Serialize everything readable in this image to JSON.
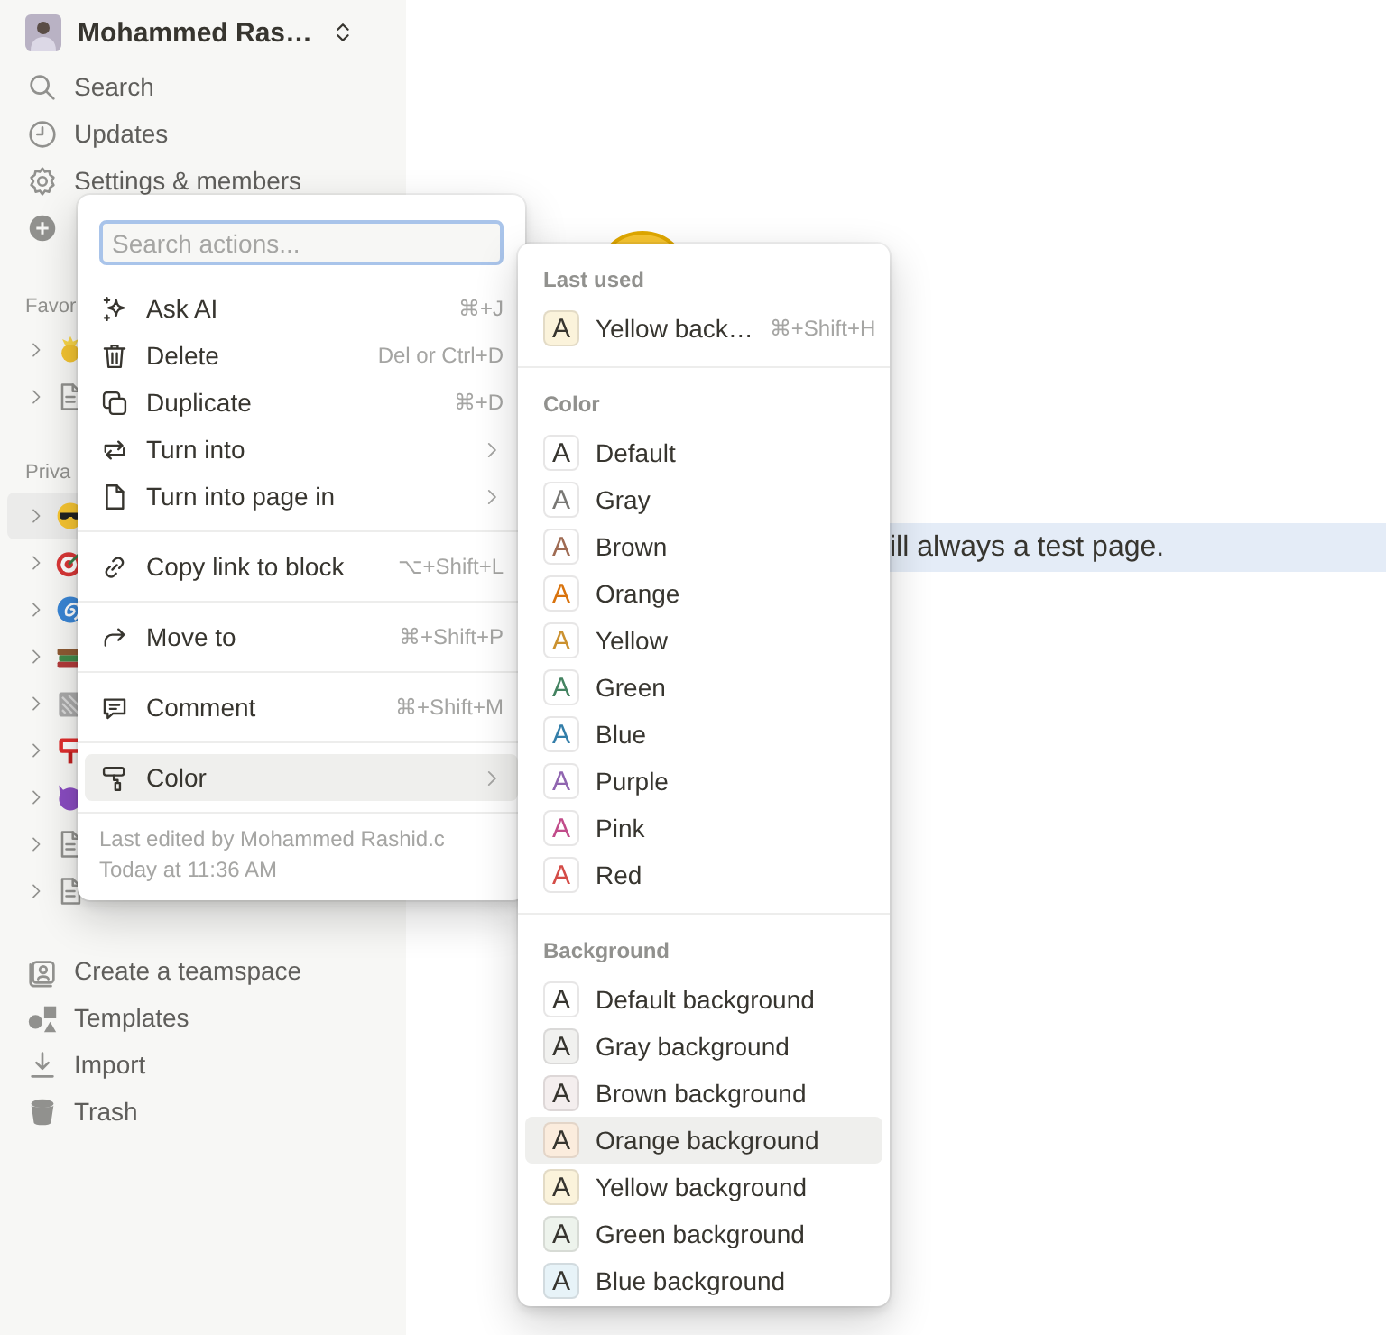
{
  "sidebar": {
    "workspace": {
      "name": "Mohammed Ras…"
    },
    "nav": [
      {
        "label": "Search"
      },
      {
        "label": "Updates"
      },
      {
        "label": "Settings & members"
      }
    ],
    "favorites": {
      "heading": "Favor",
      "pages": [
        {
          "selected": false
        },
        {
          "selected": false
        }
      ]
    },
    "private": {
      "heading": "Priva",
      "pages": [
        {
          "selected": true
        },
        {
          "selected": false
        },
        {
          "selected": false
        },
        {
          "selected": false
        },
        {
          "selected": false
        },
        {
          "selected": false
        },
        {
          "selected": false
        },
        {
          "selected": false
        },
        {
          "selected": false
        }
      ]
    },
    "footer": [
      {
        "label": "Create a teamspace"
      },
      {
        "label": "Templates"
      },
      {
        "label": "Import"
      },
      {
        "label": "Trash"
      }
    ]
  },
  "page": {
    "block": {
      "text": "ill always a test page.",
      "selected": true
    }
  },
  "action_menu": {
    "search": {
      "placeholder": "Search actions..."
    },
    "groups": [
      [
        {
          "label": "Ask AI",
          "shortcut": "⌘+J",
          "submenu": false,
          "selected": false
        },
        {
          "label": "Delete",
          "shortcut": "Del or Ctrl+D",
          "submenu": false,
          "selected": false
        },
        {
          "label": "Duplicate",
          "shortcut": "⌘+D",
          "submenu": false,
          "selected": false
        },
        {
          "label": "Turn into",
          "submenu": true,
          "selected": false
        },
        {
          "label": "Turn into page in",
          "submenu": true,
          "selected": false
        }
      ],
      [
        {
          "label": "Copy link to block",
          "shortcut": "⌥+Shift+L",
          "submenu": false,
          "selected": false
        }
      ],
      [
        {
          "label": "Move to",
          "shortcut": "⌘+Shift+P",
          "submenu": false,
          "selected": false
        }
      ],
      [
        {
          "label": "Comment",
          "shortcut": "⌘+Shift+M",
          "submenu": false,
          "selected": false
        }
      ],
      [
        {
          "label": "Color",
          "submenu": true,
          "selected": true
        }
      ]
    ],
    "footer": {
      "edited_by": "Last edited by Mohammed Rashid.c",
      "edited_at": "Today at 11:36 AM"
    }
  },
  "color_menu": {
    "sections": [
      {
        "heading": "Last used",
        "items": [
          {
            "kind": "background",
            "glyph": "A",
            "label": "Yellow back…",
            "shortcut": "⌘+Shift+H",
            "color": "#fbf3db",
            "selected": false
          }
        ]
      },
      {
        "heading": "Color",
        "items": [
          {
            "kind": "text",
            "glyph": "A",
            "label": "Default",
            "color": "#37352f",
            "selected": false
          },
          {
            "kind": "text",
            "glyph": "A",
            "label": "Gray",
            "color": "#787774",
            "selected": false
          },
          {
            "kind": "text",
            "glyph": "A",
            "label": "Brown",
            "color": "#9f6b53",
            "selected": false
          },
          {
            "kind": "text",
            "glyph": "A",
            "label": "Orange",
            "color": "#d9730d",
            "selected": false
          },
          {
            "kind": "text",
            "glyph": "A",
            "label": "Yellow",
            "color": "#cb912f",
            "selected": false
          },
          {
            "kind": "text",
            "glyph": "A",
            "label": "Green",
            "color": "#448361",
            "selected": false
          },
          {
            "kind": "text",
            "glyph": "A",
            "label": "Blue",
            "color": "#337ea9",
            "selected": false
          },
          {
            "kind": "text",
            "glyph": "A",
            "label": "Purple",
            "color": "#9065b0",
            "selected": false
          },
          {
            "kind": "text",
            "glyph": "A",
            "label": "Pink",
            "color": "#c14c8a",
            "selected": false
          },
          {
            "kind": "text",
            "glyph": "A",
            "label": "Red",
            "color": "#d44c47",
            "selected": false
          }
        ]
      },
      {
        "heading": "Background",
        "items": [
          {
            "kind": "background",
            "glyph": "A",
            "label": "Default background",
            "color": "#ffffff",
            "selected": false
          },
          {
            "kind": "background",
            "glyph": "A",
            "label": "Gray background",
            "color": "#f1f1ef",
            "selected": false
          },
          {
            "kind": "background",
            "glyph": "A",
            "label": "Brown background",
            "color": "#f4eeee",
            "selected": false
          },
          {
            "kind": "background",
            "glyph": "A",
            "label": "Orange background",
            "color": "#fbecdd",
            "selected": true
          },
          {
            "kind": "background",
            "glyph": "A",
            "label": "Yellow background",
            "color": "#fbf3db",
            "selected": false
          },
          {
            "kind": "background",
            "glyph": "A",
            "label": "Green background",
            "color": "#edf3ec",
            "selected": false
          },
          {
            "kind": "background",
            "glyph": "A",
            "label": "Blue background",
            "color": "#e7f3f8",
            "selected": false
          }
        ]
      }
    ]
  }
}
